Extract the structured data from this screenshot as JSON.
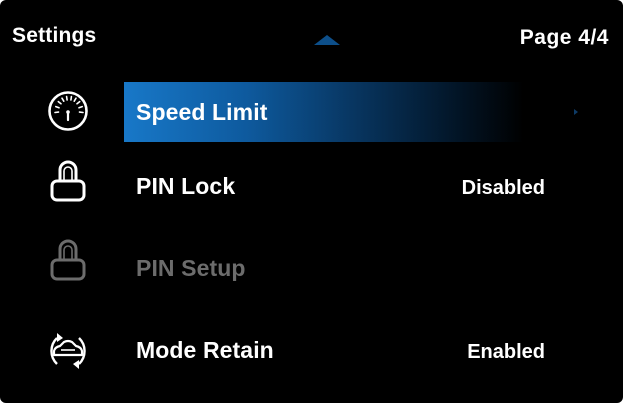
{
  "header": {
    "title": "Settings",
    "page_indicator": "Page 4/4"
  },
  "menu": {
    "items": [
      {
        "label": "Speed Limit",
        "value": "",
        "icon": "speedometer-icon",
        "selected": true,
        "enabled": true
      },
      {
        "label": "PIN Lock",
        "value": "Disabled",
        "icon": "padlock-icon",
        "selected": false,
        "enabled": true
      },
      {
        "label": "PIN Setup",
        "value": "",
        "icon": "padlock-icon",
        "selected": false,
        "enabled": false
      },
      {
        "label": "Mode Retain",
        "value": "Enabled",
        "icon": "mode-retain-icon",
        "selected": false,
        "enabled": true
      }
    ]
  },
  "colors": {
    "background": "#000000",
    "text": "#ffffff",
    "disabled_text": "#6c6c6c",
    "highlight": "#1878c8",
    "scroll_arrow": "#0d4f8a"
  }
}
